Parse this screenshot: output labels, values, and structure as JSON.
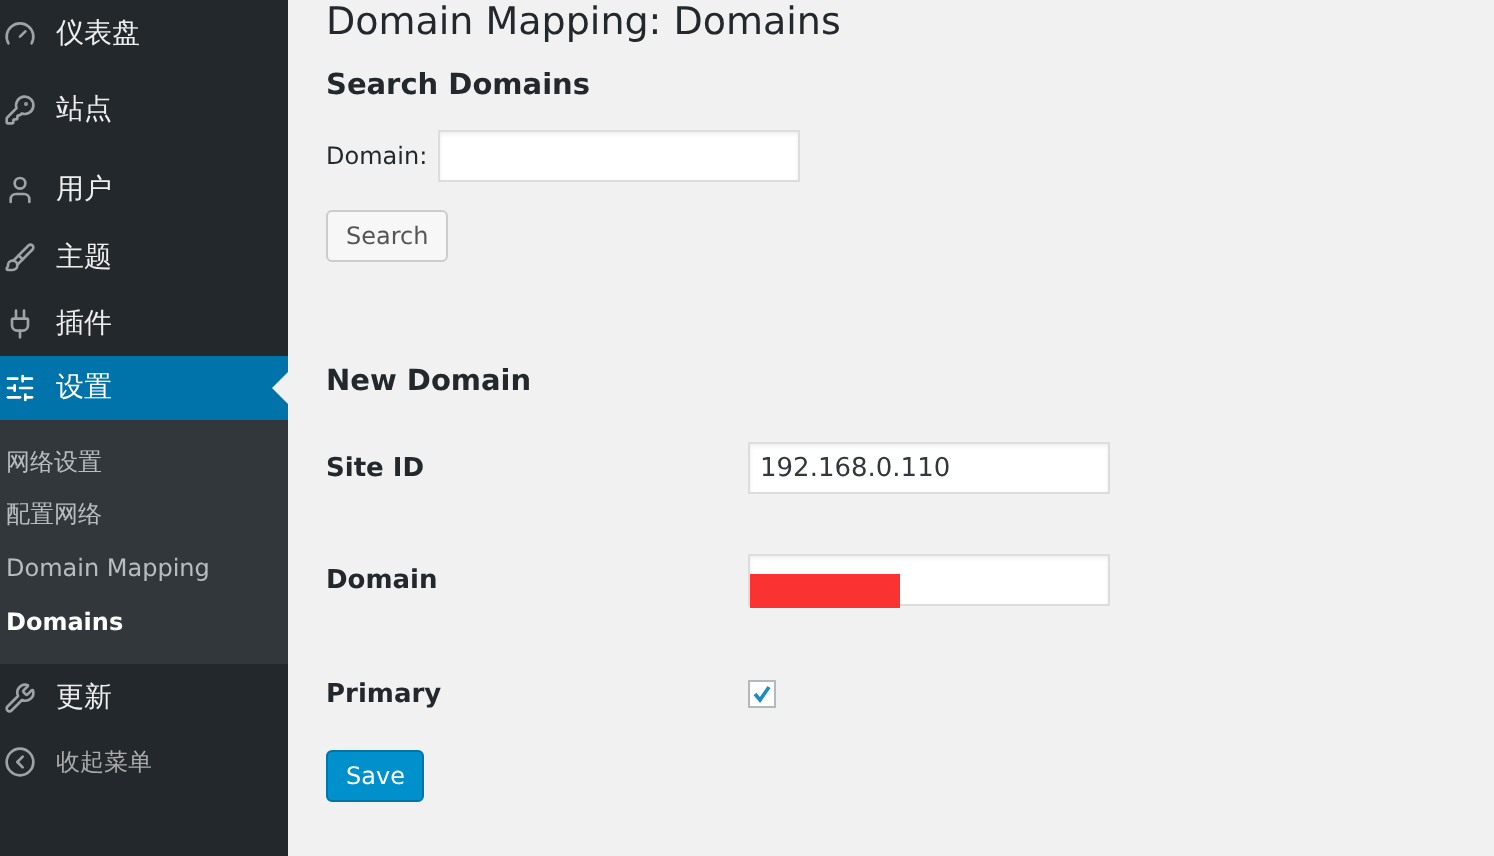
{
  "sidebar": {
    "items": [
      {
        "label": "仪表盘",
        "selected": false
      },
      {
        "label": "站点",
        "selected": false
      },
      {
        "label": "用户",
        "selected": false
      },
      {
        "label": "主题",
        "selected": false
      },
      {
        "label": "插件",
        "selected": false
      },
      {
        "label": "设置",
        "selected": true,
        "children": [
          {
            "label": "网络设置",
            "selected": false
          },
          {
            "label": "配置网络",
            "selected": false
          },
          {
            "label": "Domain Mapping",
            "selected": false
          },
          {
            "label": "Domains",
            "selected": true
          }
        ]
      },
      {
        "label": "更新",
        "selected": false
      }
    ],
    "collapse_menu": {
      "label": "收起菜单"
    }
  },
  "page_title": "Domain Mapping: Domains",
  "search": {
    "heading": "Search Domains",
    "field_label": "Domain:",
    "button": "Search"
  },
  "new_domain": {
    "heading": "New Domain",
    "site_id": {
      "label": "Site ID",
      "value": "192.168.0.110"
    },
    "domain": {
      "label": "Domain",
      "redacted": true
    },
    "primary": {
      "label": "Primary",
      "checked": true
    },
    "button": "Save"
  }
}
